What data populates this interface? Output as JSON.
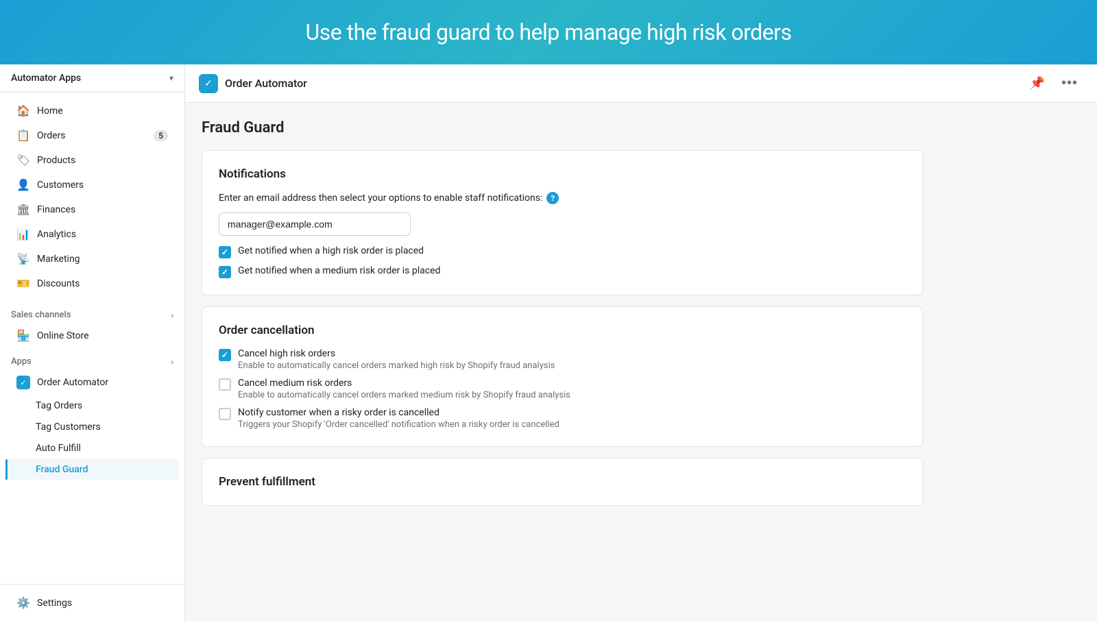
{
  "banner": {
    "text": "Use the fraud guard to help manage high risk orders"
  },
  "sidebar": {
    "dropdown_label": "Automator Apps",
    "nav_items": [
      {
        "id": "home",
        "icon": "🏠",
        "label": "Home"
      },
      {
        "id": "orders",
        "icon": "📋",
        "label": "Orders",
        "badge": "5"
      },
      {
        "id": "products",
        "icon": "🏷",
        "label": "Products"
      },
      {
        "id": "customers",
        "icon": "👤",
        "label": "Customers"
      },
      {
        "id": "finances",
        "icon": "🏛",
        "label": "Finances"
      },
      {
        "id": "analytics",
        "icon": "📊",
        "label": "Analytics"
      },
      {
        "id": "marketing",
        "icon": "📡",
        "label": "Marketing"
      },
      {
        "id": "discounts",
        "icon": "🎫",
        "label": "Discounts"
      }
    ],
    "sales_channels_header": "Sales channels",
    "sales_channels": [
      {
        "id": "online-store",
        "icon": "🏪",
        "label": "Online Store"
      }
    ],
    "apps_header": "Apps",
    "apps_expand_icon": "›",
    "apps_items": [
      {
        "id": "order-automator",
        "icon": "✅",
        "label": "Order Automator",
        "active": false
      }
    ],
    "sub_items": [
      {
        "id": "tag-orders",
        "label": "Tag Orders",
        "active": false
      },
      {
        "id": "tag-customers",
        "label": "Tag Customers",
        "active": false
      },
      {
        "id": "auto-fulfill",
        "label": "Auto Fulfill",
        "active": false
      },
      {
        "id": "fraud-guard",
        "label": "Fraud Guard",
        "active": true
      }
    ],
    "settings_label": "Settings"
  },
  "header": {
    "app_icon": "✓",
    "app_title": "Order Automator",
    "pin_icon": "📌",
    "more_icon": "···"
  },
  "page": {
    "title": "Fraud Guard",
    "notifications_card": {
      "title": "Notifications",
      "description": "Enter an email address then select your options to enable staff notifications:",
      "email_placeholder": "manager@example.com",
      "email_value": "manager@example.com",
      "checkboxes": [
        {
          "id": "high-risk-notify",
          "checked": true,
          "label": "Get notified when a high risk order is placed"
        },
        {
          "id": "medium-risk-notify",
          "checked": true,
          "label": "Get notified when a medium risk order is placed"
        }
      ]
    },
    "order_cancellation_card": {
      "title": "Order cancellation",
      "checkboxes": [
        {
          "id": "cancel-high-risk",
          "checked": true,
          "label": "Cancel high risk orders",
          "sublabel": "Enable to automatically cancel orders marked high risk by Shopify fraud analysis"
        },
        {
          "id": "cancel-medium-risk",
          "checked": false,
          "label": "Cancel medium risk orders",
          "sublabel": "Enable to automatically cancel orders marked medium risk by Shopify fraud analysis"
        },
        {
          "id": "notify-customer-cancel",
          "checked": false,
          "label": "Notify customer when a risky order is cancelled",
          "sublabel": "Triggers your Shopify 'Order cancelled' notification when a risky order is cancelled"
        }
      ]
    },
    "prevent_fulfillment_card": {
      "title": "Prevent fulfillment"
    }
  }
}
